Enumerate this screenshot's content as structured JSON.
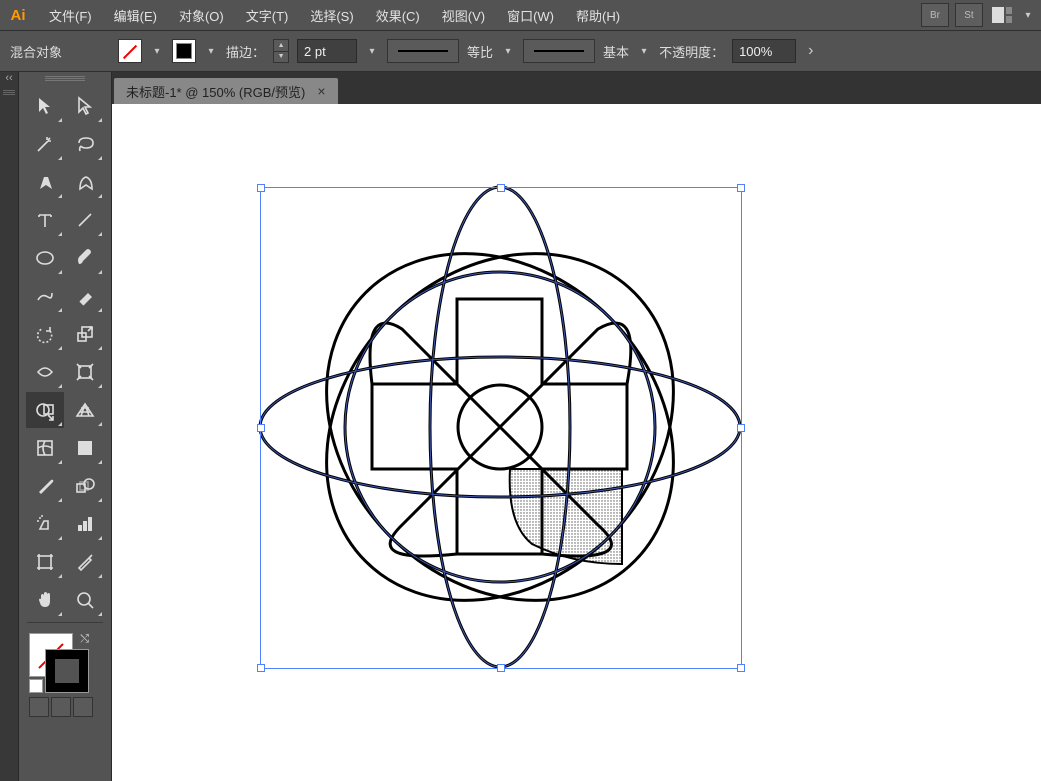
{
  "app": {
    "name": "Ai"
  },
  "menu": {
    "file": "文件(F)",
    "edit": "编辑(E)",
    "object": "对象(O)",
    "text": "文字(T)",
    "select": "选择(S)",
    "effect": "效果(C)",
    "view": "视图(V)",
    "window": "窗口(W)",
    "help": "帮助(H)",
    "br": "Br",
    "st": "St"
  },
  "control": {
    "context": "混合对象",
    "stroke_label": "描边：",
    "stroke_weight": "2 pt",
    "profile_label": "等比",
    "brush_label": "基本",
    "opacity_label": "不透明度：",
    "opacity_value": "100%"
  },
  "doc": {
    "tab_title": "未标题-1* @ 150% (RGB/预览)"
  }
}
